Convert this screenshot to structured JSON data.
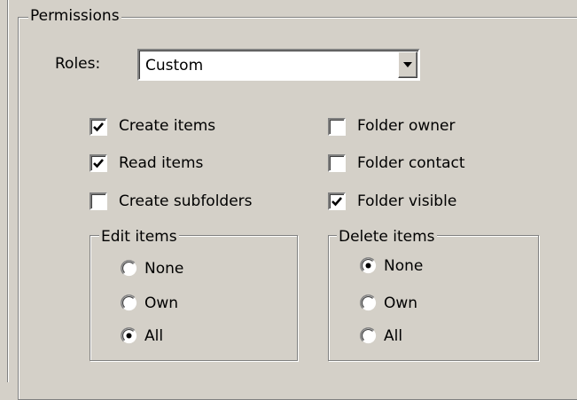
{
  "permissions": {
    "title": "Permissions",
    "roles_label": "Roles:",
    "roles_value": "Custom",
    "checkboxes": [
      {
        "label": "Create items",
        "checked": true
      },
      {
        "label": "Read items",
        "checked": true
      },
      {
        "label": "Create subfolders",
        "checked": false
      },
      {
        "label": "Folder owner",
        "checked": false
      },
      {
        "label": "Folder contact",
        "checked": false
      },
      {
        "label": "Folder visible",
        "checked": true
      }
    ],
    "edit_items": {
      "title": "Edit items",
      "options": [
        {
          "label": "None",
          "selected": false
        },
        {
          "label": "Own",
          "selected": false
        },
        {
          "label": "All",
          "selected": true
        }
      ]
    },
    "delete_items": {
      "title": "Delete items",
      "options": [
        {
          "label": "None",
          "selected": true
        },
        {
          "label": "Own",
          "selected": false
        },
        {
          "label": "All",
          "selected": false
        }
      ]
    }
  },
  "icons": {
    "check": "check-mark-icon",
    "dropdown": "chevron-down-icon",
    "radio_dot": "radio-dot-icon"
  },
  "colors": {
    "dialog_bg": "#d4d0c8",
    "field_bg": "#ffffff",
    "shadow": "#808080",
    "highlight": "#ffffff"
  }
}
